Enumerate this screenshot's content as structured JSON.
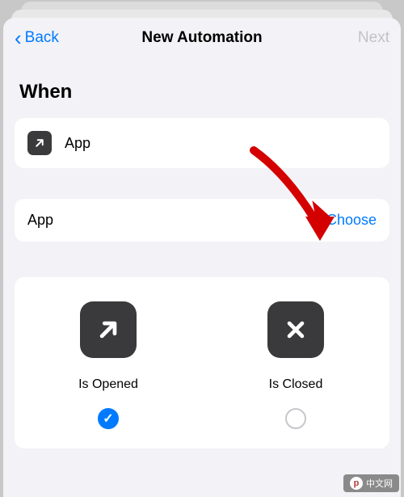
{
  "nav": {
    "back": "Back",
    "title": "New Automation",
    "next": "Next"
  },
  "section_when": "When",
  "trigger": {
    "label": "App"
  },
  "app_row": {
    "label": "App",
    "choose": "Choose"
  },
  "options": {
    "opened": {
      "label": "Is Opened",
      "selected": true
    },
    "closed": {
      "label": "Is Closed",
      "selected": false
    }
  },
  "watermark": "中文网",
  "colors": {
    "accent": "#007aff",
    "arrow": "#d40000"
  }
}
